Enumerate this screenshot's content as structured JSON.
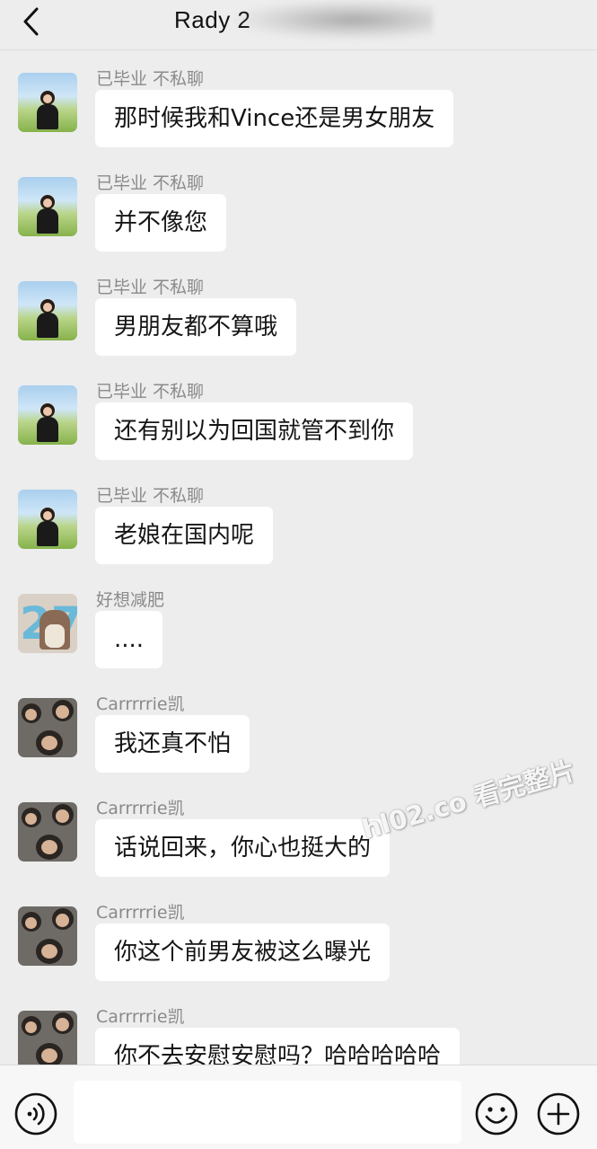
{
  "header": {
    "title": "Rady 2"
  },
  "watermark": "hl02.co 看完整片",
  "messages": [
    {
      "sender": "已毕业 不私聊",
      "avatar": "girl-field-avatar",
      "text": "那时候我和Vince还是男女朋友"
    },
    {
      "sender": "已毕业 不私聊",
      "avatar": "girl-field-avatar",
      "text": "并不像您"
    },
    {
      "sender": "已毕业 不私聊",
      "avatar": "girl-field-avatar",
      "text": "男朋友都不算哦"
    },
    {
      "sender": "已毕业 不私聊",
      "avatar": "girl-field-avatar",
      "text": "还有别以为回国就管不到你"
    },
    {
      "sender": "已毕业 不私聊",
      "avatar": "girl-field-avatar",
      "text": "老娘在国内呢"
    },
    {
      "sender": "好想减肥",
      "avatar": "number-27-avatar",
      "text": "...."
    },
    {
      "sender": "Carrrrrie凯",
      "avatar": "group-photo-avatar",
      "text": "我还真不怕"
    },
    {
      "sender": "Carrrrrie凯",
      "avatar": "group-photo-avatar",
      "text": "话说回来，你心也挺大的"
    },
    {
      "sender": "Carrrrrie凯",
      "avatar": "group-photo-avatar",
      "text": "你这个前男友被这么曝光"
    },
    {
      "sender": "Carrrrrie凯",
      "avatar": "group-photo-avatar",
      "text": "你不去安慰安慰吗？哈哈哈哈哈"
    }
  ],
  "footer": {
    "input_value": "",
    "icons": [
      "voice-icon",
      "emoji-icon",
      "plus-icon"
    ]
  }
}
